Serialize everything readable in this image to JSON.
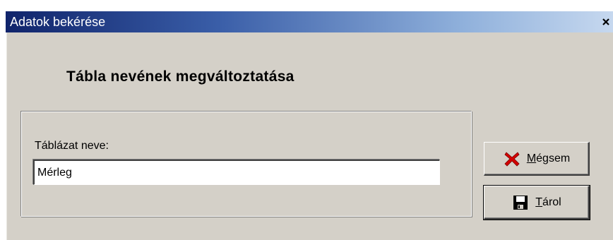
{
  "window": {
    "title": "Adatok bekérése",
    "close_glyph": "x"
  },
  "dialog": {
    "heading": "Tábla nevének megváltoztatása"
  },
  "form": {
    "label": "Táblázat neve:",
    "value": "Mérleg"
  },
  "buttons": {
    "cancel": {
      "accel": "M",
      "rest": "égsem",
      "icon": "red-x-icon"
    },
    "save": {
      "accel": "T",
      "rest": "árol",
      "icon": "floppy-disk-icon"
    }
  },
  "colors": {
    "face": "#d4d0c8",
    "title_start": "#10246b",
    "title_end": "#c6d8ef",
    "cancel_icon": "#d40000"
  }
}
